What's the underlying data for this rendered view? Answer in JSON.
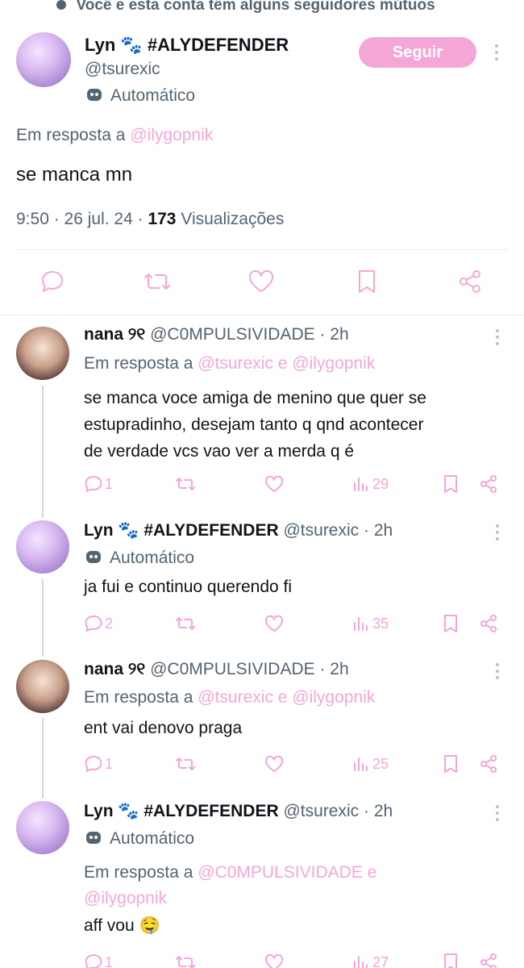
{
  "mutual_banner": "Você e esta conta têm alguns seguidores mútuos",
  "main_post": {
    "display_name": "Lyn 🐾 #ALYDEFENDER",
    "handle": "@tsurexic",
    "follow_label": "Seguir",
    "automated_label": "Automático",
    "reply_prefix": "Em resposta a",
    "reply_to": "@ilygopnik",
    "text": "se manca mn",
    "time": "9:50 · 26 jul. 24 ·",
    "views_count": "173",
    "views_label": "Visualizações"
  },
  "replies": [
    {
      "display_name": "nana ୨୧",
      "handle": "@C0MPULSIVIDADE · 2h",
      "reply_line1": "Em resposta a",
      "reply_mentions1": "@tsurexic e @ilygopnik",
      "text_lines": [
        "se manca voce amiga de menino que quer se",
        "estupradinho, desejam tanto q qnd acontecer",
        "de verdade vcs vao ver a merda q é"
      ],
      "replies_count": "1",
      "views_count": "29"
    },
    {
      "display_name": "Lyn 🐾 #ALYDEFENDER",
      "handle": "@tsurexic · 2h",
      "automated_label": "Automático",
      "text_lines": [
        "ja fui e continuo querendo fi"
      ],
      "replies_count": "2",
      "views_count": "35"
    },
    {
      "display_name": "nana ୨୧",
      "handle": "@C0MPULSIVIDADE · 2h",
      "reply_line1": "Em resposta a",
      "reply_mentions1": "@tsurexic e @ilygopnik",
      "text_lines": [
        "ent vai denovo praga"
      ],
      "replies_count": "1",
      "views_count": "25"
    },
    {
      "display_name": "Lyn 🐾 #ALYDEFENDER",
      "handle": "@tsurexic · 2h",
      "automated_label": "Automático",
      "reply_line1": "Em resposta a",
      "reply_mentions1": "@C0MPULSIVIDADE e",
      "reply_mentions2": "@ilygopnik",
      "text_lines": [
        "aff vou 🤤"
      ],
      "replies_count": "1",
      "views_count": "27"
    }
  ],
  "colors": {
    "accent": "#f4a6d7",
    "text": "#0f1419",
    "muted": "#536471"
  }
}
